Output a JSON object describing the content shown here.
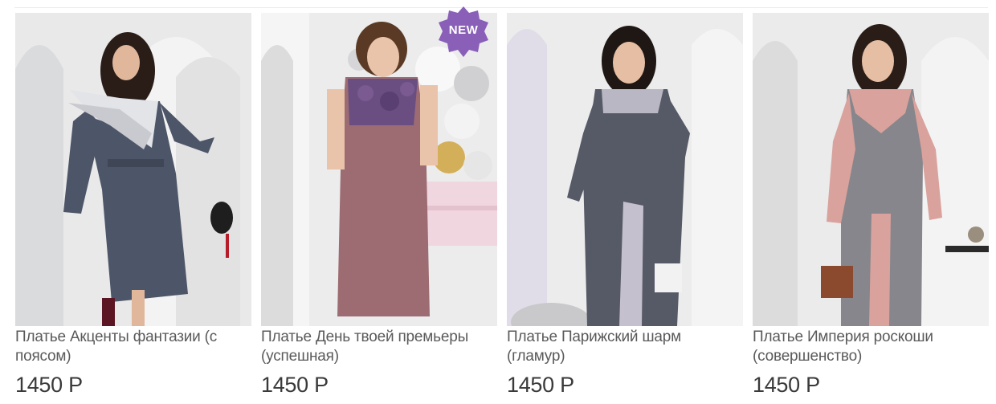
{
  "products": [
    {
      "name": "Платье Акценты фантазии (с поясом)",
      "price": "1450 Р"
    },
    {
      "name": "Платье День твоей премьеры (успешная)",
      "price": "1450 Р",
      "badge": "NEW",
      "badge_color": "#8a5fb8"
    },
    {
      "name": "Платье Парижский шарм (гламур)",
      "price": "1450 Р"
    },
    {
      "name": "Платье Империя роскоши (совершенство)",
      "price": "1450 Р"
    }
  ],
  "colors": {
    "dress_1": "#4d5668",
    "dress_2": "#9c6c72",
    "dress_3": "#565a66",
    "dress_4": "#86868c",
    "lace_4": "#d9a29c"
  },
  "icons": [
    "product-photo",
    "new-badge-icon"
  ]
}
